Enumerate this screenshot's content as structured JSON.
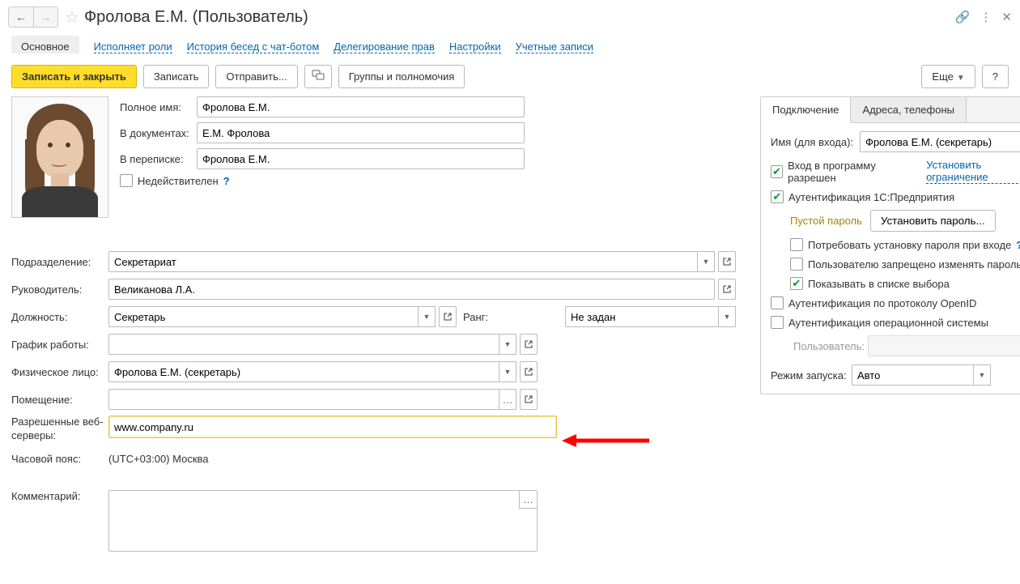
{
  "header": {
    "title": "Фролова Е.М. (Пользователь)"
  },
  "nav_tabs": {
    "main": "Основное",
    "roles": "Исполняет роли",
    "chat": "История бесед с чат-ботом",
    "deleg": "Делегирование прав",
    "settings": "Настройки",
    "accounts": "Учетные записи"
  },
  "toolbar": {
    "save_close": "Записать и закрыть",
    "save": "Записать",
    "send": "Отправить...",
    "groups": "Группы и полномочия",
    "more": "Еще",
    "help": "?"
  },
  "labels": {
    "fullname": "Полное имя:",
    "indocs": "В документах:",
    "inmail": "В переписке:",
    "inactive": "Недействителен",
    "dept": "Подразделение:",
    "manager": "Руководитель:",
    "position": "Должность:",
    "rank": "Ранг:",
    "schedule": "График работы:",
    "person": "Физическое лицо:",
    "room": "Помещение:",
    "webservers": "Разрешенные веб-серверы:",
    "tz": "Часовой пояс:",
    "comment": "Комментарий:"
  },
  "values": {
    "fullname": "Фролова Е.М.",
    "indocs": "Е.М. Фролова",
    "inmail": "Фролова Е.М.",
    "dept": "Секретариат",
    "manager": "Великанова Л.А.",
    "position": "Секретарь",
    "rank": "Не задан",
    "schedule": "",
    "person": "Фролова Е.М. (секретарь)",
    "room": "",
    "webservers": "www.company.ru",
    "tz": "(UTC+03:00) Москва",
    "comment": ""
  },
  "right": {
    "tab_conn": "Подключение",
    "tab_addr": "Адреса, телефоны",
    "login_lbl": "Имя (для входа):",
    "login_val": "Фролова Е.М. (секретарь)",
    "allowed": "Вход в программу разрешен",
    "restrict_link": "Установить ограничение",
    "auth1c": "Аутентификация 1С:Предприятия",
    "empty_pwd": "Пустой пароль",
    "set_pwd": "Установить пароль...",
    "require_pwd": "Потребовать установку пароля при входе",
    "no_change": "Пользователю запрещено изменять пароль",
    "show_list": "Показывать в списке выбора",
    "auth_openid": "Аутентификация по протоколу OpenID",
    "auth_os": "Аутентификация операционной системы",
    "user_lbl": "Пользователь:",
    "user_val": "",
    "mode_lbl": "Режим запуска:",
    "mode_val": "Авто"
  }
}
